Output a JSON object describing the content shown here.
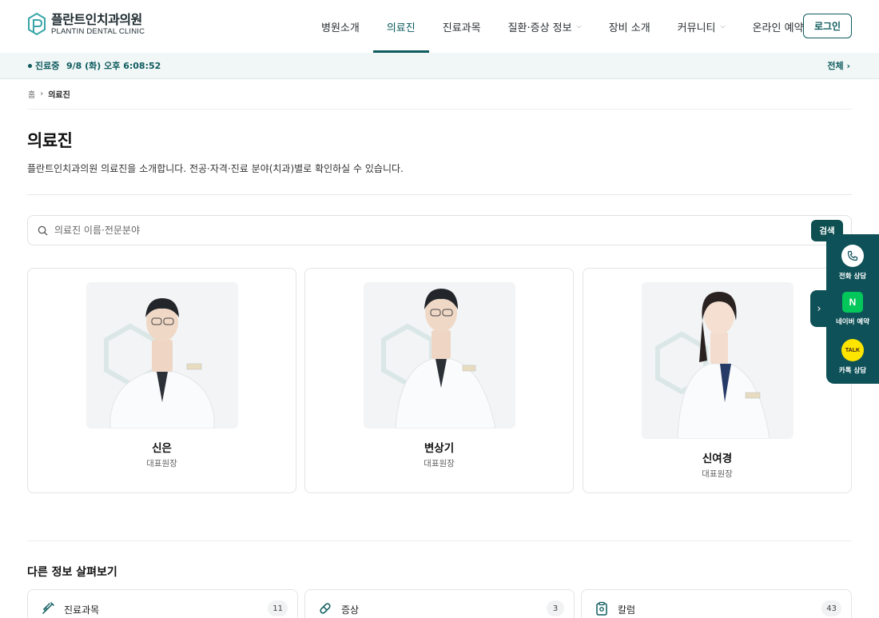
{
  "header": {
    "logo_ko": "플란트인치과의원",
    "logo_en": "PLANTIN DENTAL CLINIC",
    "nav": [
      {
        "label": "병원소개",
        "dropdown": false,
        "active": false
      },
      {
        "label": "의료진",
        "dropdown": false,
        "active": true
      },
      {
        "label": "진료과목",
        "dropdown": false,
        "active": false
      },
      {
        "label": "질환·증상 정보",
        "dropdown": true,
        "active": false
      },
      {
        "label": "장비 소개",
        "dropdown": false,
        "active": false
      },
      {
        "label": "커뮤니티",
        "dropdown": true,
        "active": false
      },
      {
        "label": "온라인 예약",
        "dropdown": false,
        "active": false
      }
    ],
    "login_label": "로그인"
  },
  "status": {
    "label": "진료중",
    "datetime": "9/8 (화) 오후 6:08:52",
    "all_link": "전체 ›"
  },
  "breadcrumb": {
    "home": "홈",
    "separator": "›",
    "current": "의료진"
  },
  "page": {
    "title": "의료진",
    "description": "플란트인치과의원 의료진을 소개합니다. 전공·자격·진료 분야(치과)별로 확인하실 수 있습니다."
  },
  "search": {
    "placeholder": "의료진 이름·전문분야",
    "button_label": "검색"
  },
  "doctors": [
    {
      "name": "신은",
      "title": "대표원장"
    },
    {
      "name": "변상기",
      "title": "대표원장"
    },
    {
      "name": "신여경",
      "title": "대표원장"
    }
  ],
  "more": {
    "title": "다른 정보 살펴보기",
    "items": [
      {
        "label": "진료과목",
        "count": "11",
        "icon": "syringe-icon"
      },
      {
        "label": "증상",
        "count": "3",
        "icon": "pill-icon"
      },
      {
        "label": "칼럼",
        "count": "43",
        "icon": "clipboard-icon"
      }
    ]
  },
  "side": {
    "toggle": "›",
    "items": [
      {
        "label": "전화 상담",
        "icon": "phone-icon"
      },
      {
        "label": "네이버 예약",
        "icon": "naver-icon",
        "glyph": "N"
      },
      {
        "label": "카톡 상담",
        "icon": "kakao-talk-icon",
        "glyph": "TALK"
      }
    ]
  },
  "colors": {
    "brand": "#0e5b5e",
    "naver": "#03c75a",
    "kakao": "#fee500"
  }
}
